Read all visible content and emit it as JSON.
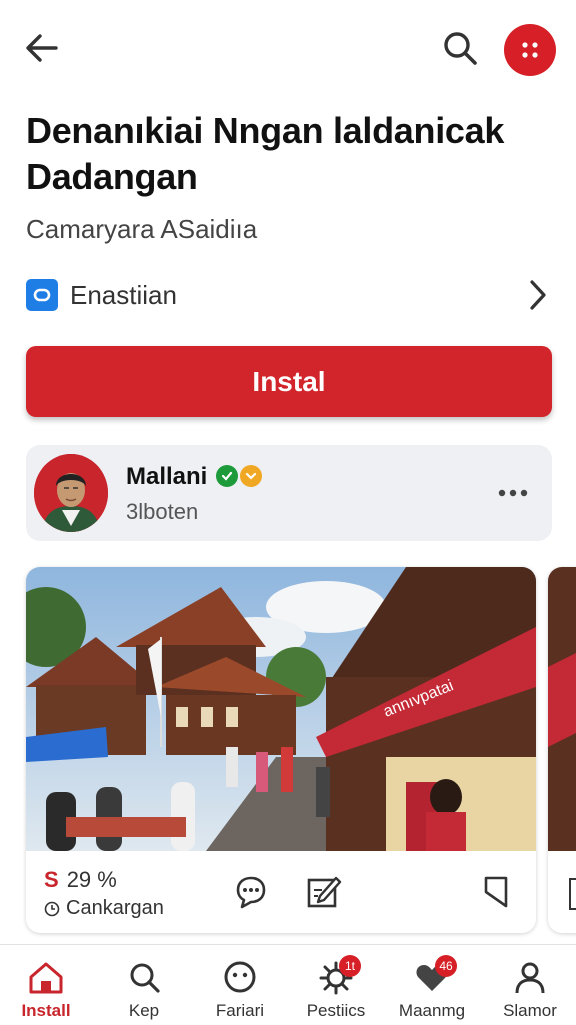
{
  "app": {
    "title": "Denanıkiai Nngan laldanicak Dadangan",
    "subtitle": "Camaryara ASaidiıa"
  },
  "category": {
    "label": "Enastiian",
    "icon": "app-square-icon"
  },
  "install_button": {
    "label": "Instal"
  },
  "author": {
    "name": "Mallani",
    "sub": "3lboten",
    "badges": [
      "verified-check-icon",
      "gold-check-icon"
    ]
  },
  "post": {
    "price_symbol": "S",
    "price_value": "29 %",
    "status": "Cankargan",
    "banner_text": "annıvpatai",
    "actions": [
      "comment-icon",
      "edit-icon",
      "bookmark-icon"
    ]
  },
  "bottom_nav": {
    "items": [
      {
        "label": "Install",
        "icon": "home-icon",
        "active": true
      },
      {
        "label": "Kep",
        "icon": "search-icon",
        "active": false
      },
      {
        "label": "Fariari",
        "icon": "smile-icon",
        "active": false
      },
      {
        "label": "Pestiics",
        "icon": "gear-icon",
        "badge": "1t",
        "active": false
      },
      {
        "label": "Maanmg",
        "icon": "heart-icon",
        "badge": "46",
        "active": false
      },
      {
        "label": "Slamor",
        "icon": "profile-icon",
        "active": false
      }
    ]
  },
  "colors": {
    "accent": "#d2252b",
    "card_bg": "#eef0f4",
    "category_blue": "#1f7ee6"
  }
}
